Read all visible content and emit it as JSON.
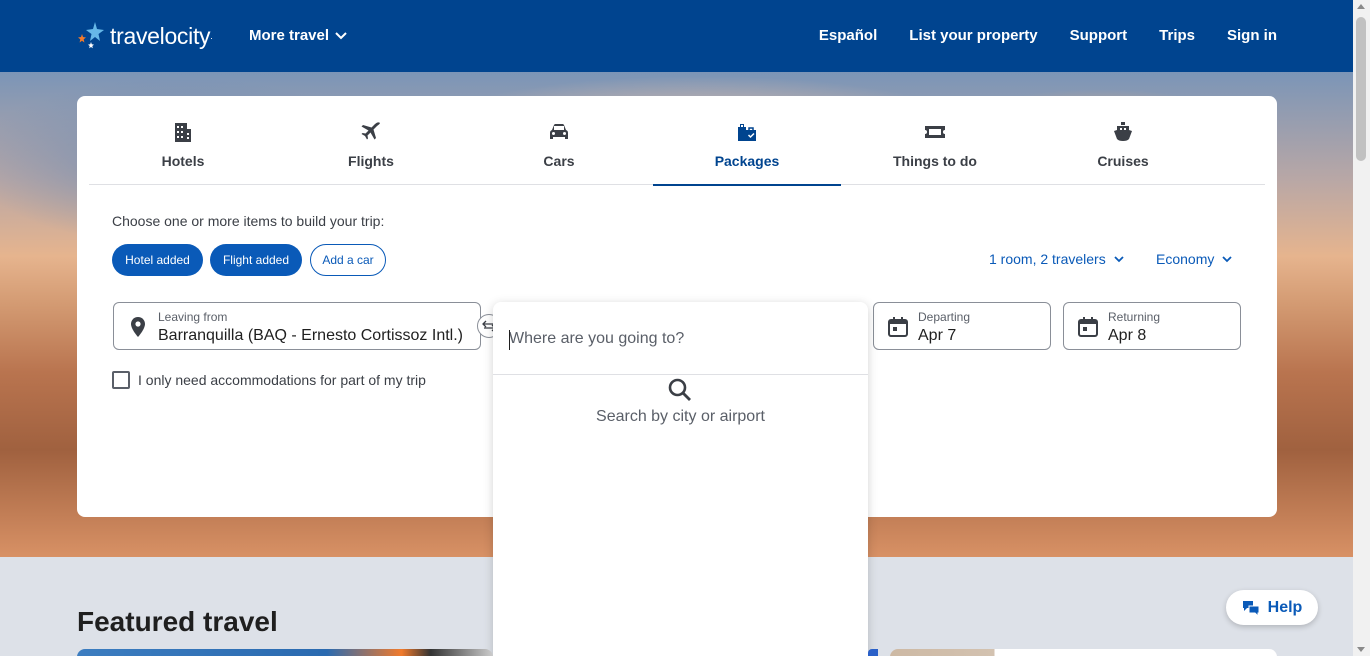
{
  "header": {
    "logo_text": "travelocity",
    "logo_tm": ".",
    "more_travel": "More travel",
    "nav": [
      "Español",
      "List your property",
      "Support",
      "Trips",
      "Sign in"
    ]
  },
  "tabs": [
    {
      "label": "Hotels",
      "icon": "building-icon"
    },
    {
      "label": "Flights",
      "icon": "airplane-icon"
    },
    {
      "label": "Cars",
      "icon": "car-icon"
    },
    {
      "label": "Packages",
      "icon": "luggage-icon",
      "active": true
    },
    {
      "label": "Things to do",
      "icon": "ticket-icon"
    },
    {
      "label": "Cruises",
      "icon": "ship-icon"
    }
  ],
  "build": {
    "label": "Choose one or more items to build your trip:",
    "pills": [
      "Hotel added",
      "Flight added",
      "Add a car"
    ]
  },
  "options": {
    "travelers": "1 room, 2 travelers",
    "cabin": "Economy"
  },
  "fields": {
    "leaving_label": "Leaving from",
    "leaving_value": "Barranquilla (BAQ - Ernesto Cortissoz Intl.)",
    "departing_label": "Departing",
    "departing_value": "Apr 7",
    "returning_label": "Returning",
    "returning_value": "Apr 8"
  },
  "checkbox_label": "I only need accommodations for part of my trip",
  "destination": {
    "placeholder": "Where are you going to?",
    "hint": "Search by city or airport"
  },
  "featured_title": "Featured travel",
  "help_label": "Help",
  "colors": {
    "brand": "#00448f",
    "accent": "#0a5ab8"
  }
}
